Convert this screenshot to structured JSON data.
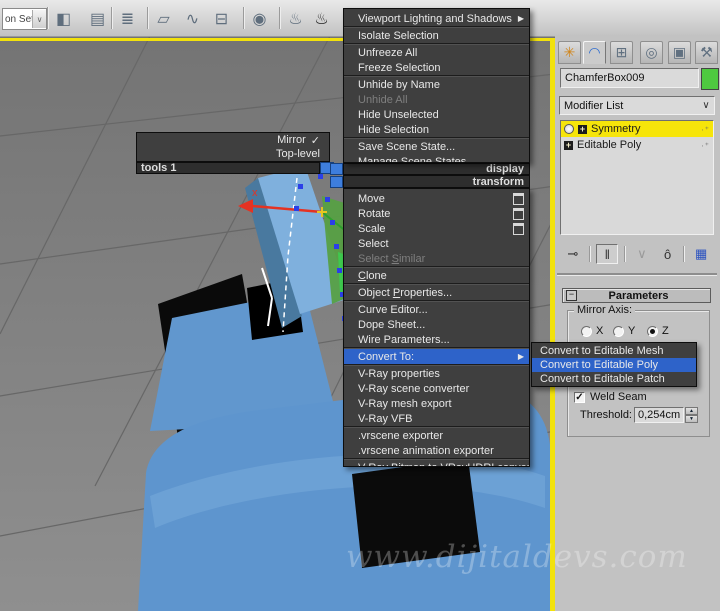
{
  "toolbar": {
    "selection_set_value": "on Set",
    "icons": [
      {
        "name": "mirror-icon",
        "glyph": "◧"
      },
      {
        "name": "align-icon",
        "glyph": "▤"
      },
      {
        "name": "layer-manager-icon",
        "glyph": "≣"
      },
      {
        "name": "graphite-ribbon-icon",
        "glyph": "▱"
      },
      {
        "name": "curve-editor-icon",
        "glyph": "∿"
      },
      {
        "name": "schematic-view-icon",
        "glyph": "⊟"
      },
      {
        "name": "material-editor-icon",
        "glyph": "◉"
      },
      {
        "name": "render-setup-icon",
        "glyph": "♨"
      },
      {
        "name": "render-production-icon",
        "glyph": "♨",
        "dark": true
      }
    ]
  },
  "quad_menu": {
    "tools_header": "tools 1",
    "display_header": "display",
    "transform_header": "transform",
    "left_items": [
      {
        "label": "Mirror",
        "checked": true
      },
      {
        "label": "Top-level"
      }
    ],
    "display_items": [
      {
        "label": "Viewport Lighting and Shadows",
        "arrow": true,
        "sep": true
      },
      {
        "label": "Isolate Selection",
        "sep": true
      },
      {
        "label": "Unfreeze All"
      },
      {
        "label": "Freeze Selection",
        "sep": true
      },
      {
        "label": "Unhide by Name"
      },
      {
        "label": "Unhide All",
        "disabled": true
      },
      {
        "label": "Hide Unselected"
      },
      {
        "label": "Hide Selection",
        "sep": true
      },
      {
        "label": "Save Scene State..."
      },
      {
        "label": "Manage Scene States..."
      }
    ],
    "transform_items": [
      {
        "label": "Move",
        "settings": true
      },
      {
        "label": "Rotate",
        "settings": true
      },
      {
        "label": "Scale",
        "settings": true
      },
      {
        "label": "Select"
      },
      {
        "label": "Select Similar",
        "disabled": true,
        "u": 7,
        "sep": true
      },
      {
        "label": "Clone",
        "u": 0,
        "sep": true
      },
      {
        "label": "Object Properties...",
        "u": 7,
        "sep": true
      },
      {
        "label": "Curve Editor..."
      },
      {
        "label": "Dope Sheet..."
      },
      {
        "label": "Wire Parameters...",
        "sep": true
      },
      {
        "label": "Convert To:",
        "arrow": true,
        "selected": true,
        "sep": true
      },
      {
        "label": "V-Ray properties"
      },
      {
        "label": "V-Ray scene converter"
      },
      {
        "label": "V-Ray mesh export"
      },
      {
        "label": "V-Ray VFB",
        "sep": true
      },
      {
        "label": ".vrscene exporter"
      },
      {
        "label": ".vrscene animation exporter",
        "sep": true
      },
      {
        "label": "V-Ray Bitmap to VRayHDRI converter"
      }
    ],
    "submenu_items": [
      {
        "label": "Convert to Editable Mesh"
      },
      {
        "label": "Convert to Editable Poly",
        "selected": true
      },
      {
        "label": "Convert to Editable Patch"
      }
    ]
  },
  "command_panel": {
    "tabs": [
      {
        "name": "create",
        "glyph": "✳"
      },
      {
        "name": "modify",
        "glyph": "◠",
        "active": true
      },
      {
        "name": "hierarchy",
        "glyph": "⊞"
      },
      {
        "name": "motion",
        "glyph": "◎"
      },
      {
        "name": "display",
        "glyph": "▣"
      },
      {
        "name": "utilities",
        "glyph": "⚒"
      }
    ],
    "object_name": "ChamferBox009",
    "modifier_list_label": "Modifier List",
    "modifier_stack": [
      {
        "label": "Symmetry",
        "selected": true,
        "bulb": true
      },
      {
        "label": "Editable Poly"
      }
    ],
    "stack_tools": [
      {
        "name": "pin-stack-icon",
        "glyph": "⊸"
      },
      {
        "name": "show-end-result-icon",
        "glyph": "‖",
        "framed": true
      },
      {
        "name": "make-unique-icon",
        "glyph": "∨",
        "disabled": true
      },
      {
        "name": "remove-modifier-icon",
        "glyph": "ô"
      },
      {
        "name": "configure-modifier-sets-icon",
        "glyph": "▦",
        "blue": true
      }
    ],
    "parameters": {
      "header": "Parameters",
      "mirror_axis_label": "Mirror Axis:",
      "axis_options": [
        {
          "label": "X"
        },
        {
          "label": "Y"
        },
        {
          "label": "Z",
          "selected": true
        }
      ],
      "weld_seam_label": "Weld Seam",
      "weld_seam_checked": true,
      "threshold_label": "Threshold:",
      "threshold_value": "0,254cm"
    }
  },
  "viewport": {
    "axis_label": "x",
    "watermark": "www.dijitaldevs.com"
  },
  "colors": {
    "menu_highlight_blue": "#2e63c9",
    "quad_square_blue": "#3e7edd",
    "modifier_selected_yellow": "#f6e50a",
    "viewport_border_yellow": "#f2e20c",
    "object_blue": "#5e95ce",
    "swatch_green": "#4ec93f"
  }
}
